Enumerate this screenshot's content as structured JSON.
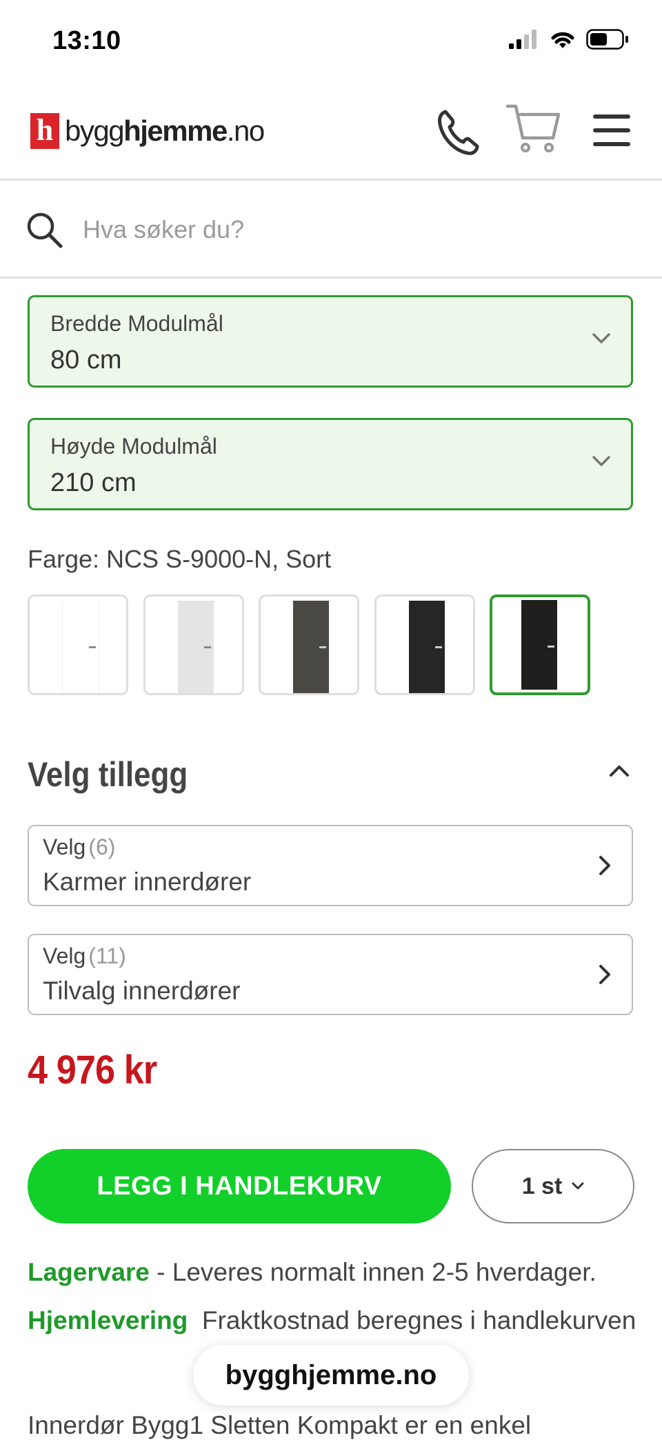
{
  "status": {
    "time": "13:10"
  },
  "header": {
    "logo_mark": "h",
    "logo_text_a": "bygg",
    "logo_text_b": "hjemme",
    "logo_text_c": ".no"
  },
  "search": {
    "placeholder": "Hva søker du?"
  },
  "options": {
    "width": {
      "label": "Bredde Modulmål",
      "value": "80 cm"
    },
    "height": {
      "label": "Høyde Modulmål",
      "value": "210 cm"
    }
  },
  "color": {
    "label": "Farge: NCS S-9000-N, Sort",
    "swatches": [
      {
        "color": "#ffffff"
      },
      {
        "color": "#e4e4e4"
      },
      {
        "color": "#4a4843"
      },
      {
        "color": "#262626"
      },
      {
        "color": "#1f1f1d",
        "selected": true
      }
    ]
  },
  "addons": {
    "title": "Velg tillegg",
    "items": [
      {
        "prefix": "Velg",
        "count": "(6)",
        "name": "Karmer innerdører"
      },
      {
        "prefix": "Velg",
        "count": "(11)",
        "name": "Tilvalg innerdører"
      }
    ]
  },
  "price": "4 976 kr",
  "cart": {
    "button": "LEGG I HANDLEKURV",
    "qty": "1 st"
  },
  "delivery": {
    "stock_label": "Lagervare",
    "stock_text": " - Leveres normalt innen 2-5 hverdager.",
    "home_label": "Hjemlevering",
    "home_text": "  Fraktkostnad beregnes i handlekurven"
  },
  "url_pill": "bygghjemme.no",
  "description_start": "Innerdør Bygg1 Sletten Kompakt er en enkel",
  "colors": {
    "accent_green": "#12cf29",
    "border_green": "#2e9b2e",
    "price_red": "#c8161d"
  }
}
